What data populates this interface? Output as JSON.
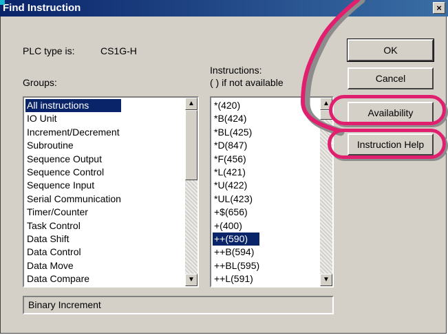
{
  "window": {
    "title": "Find Instruction",
    "close_label": "×"
  },
  "plc": {
    "label": "PLC type is:",
    "value": "CS1G-H"
  },
  "groups": {
    "label": "Groups:",
    "items": [
      "All instructions",
      "IO Unit",
      "Increment/Decrement",
      "Subroutine",
      "Sequence Output",
      "Sequence Control",
      "Sequence Input",
      "Serial Communication",
      "Timer/Counter",
      "Task Control",
      "Data Shift",
      "Data Control",
      "Data Move",
      "Data Compare"
    ],
    "selected_index": 0
  },
  "instructions": {
    "label_line1": "Instructions:",
    "label_line2": "( ) if not available",
    "items": [
      "*(420)",
      "*B(424)",
      "*BL(425)",
      "*D(847)",
      "*F(456)",
      "*L(421)",
      "*U(422)",
      "*UL(423)",
      "+$(656)",
      "+(400)",
      "++(590)",
      "++B(594)",
      "++BL(595)",
      "++L(591)"
    ],
    "selected_index": 10
  },
  "buttons": {
    "ok": "OK",
    "cancel": "Cancel",
    "availability": "Availability",
    "instruction_help": "Instruction Help"
  },
  "status": {
    "text": "Binary Increment"
  },
  "colors": {
    "highlight": "#e0206f",
    "selection": "#0a246a",
    "titlebar": "#0a246a"
  }
}
